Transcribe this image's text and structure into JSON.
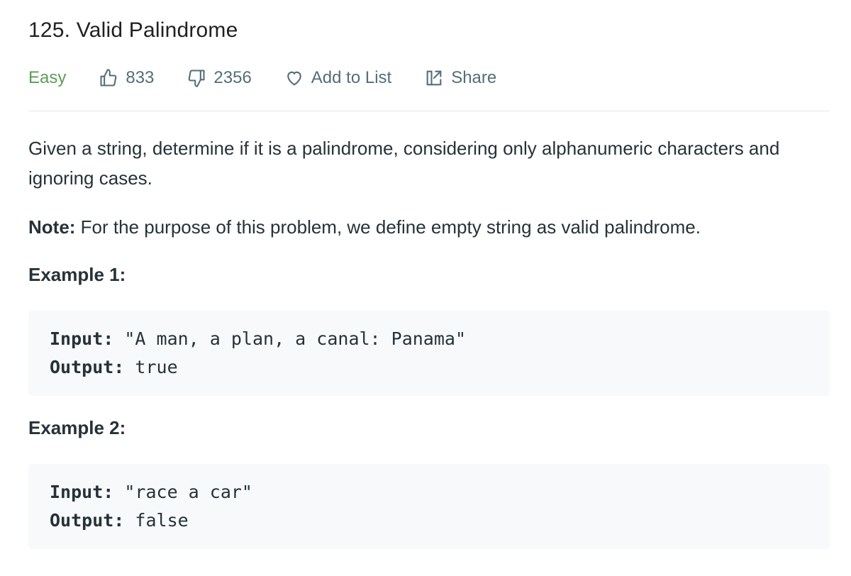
{
  "problem": {
    "title": "125. Valid Palindrome",
    "difficulty": "Easy",
    "likes": "833",
    "dislikes": "2356",
    "add_to_list_label": "Add to List",
    "share_label": "Share"
  },
  "description": {
    "text": "Given a string, determine if it is a palindrome, considering only alphanumeric characters and ignoring cases.",
    "note_label": "Note:",
    "note_text": " For the purpose of this problem, we define empty string as valid palindrome."
  },
  "examples": [
    {
      "heading": "Example 1:",
      "input_label": "Input:",
      "input_value": " \"A man, a plan, a canal: Panama\"",
      "output_label": "Output:",
      "output_value": " true"
    },
    {
      "heading": "Example 2:",
      "input_label": "Input:",
      "input_value": " \"race a car\"",
      "output_label": "Output:",
      "output_value": " false"
    }
  ],
  "icons": {
    "like": "thumbs-up-icon",
    "dislike": "thumbs-down-icon",
    "add_to_list": "heart-icon",
    "share": "share-icon"
  },
  "colors": {
    "difficulty_easy": "#5c9d56",
    "text": "#263238",
    "muted": "#546e7a",
    "code_bg": "#f7f9fa"
  }
}
